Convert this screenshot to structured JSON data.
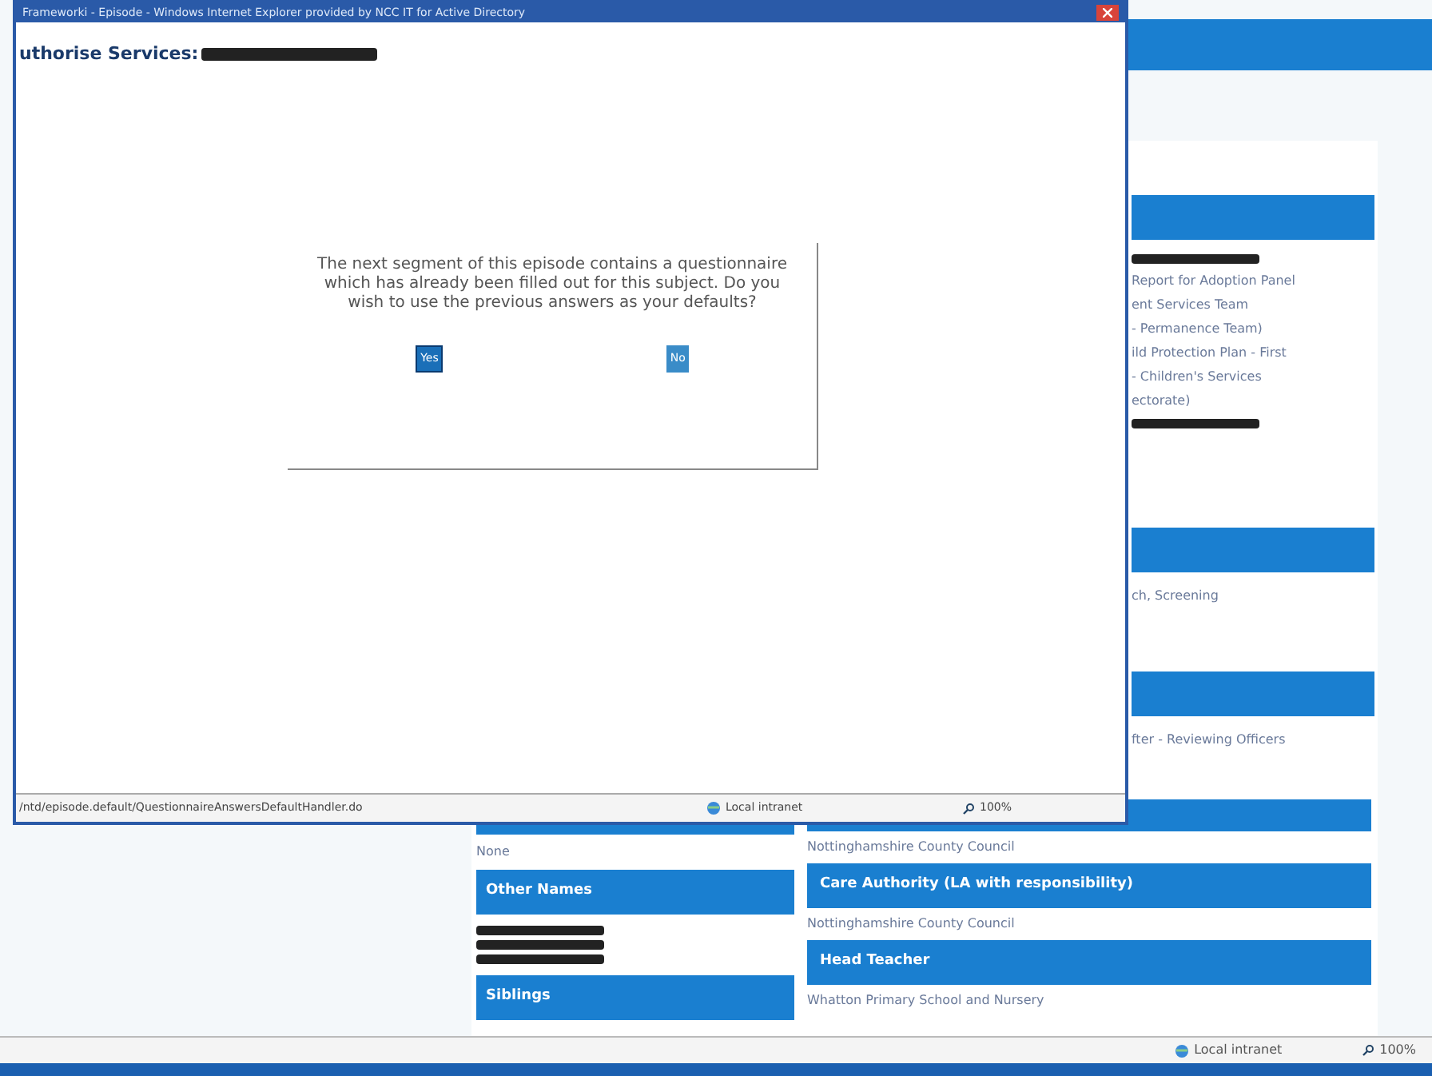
{
  "popup": {
    "title": "Frameworki - Episode - Windows Internet Explorer provided by NCC IT for Active Directory",
    "heading": "uthorise Services:",
    "dialog": {
      "message": "The next segment of this episode contains a questionnaire which has already been filled out for this subject. Do you wish to use the previous answers as your defaults?",
      "buttons": [
        {
          "label": "Yes",
          "selected": true
        },
        {
          "label": "No",
          "selected": false
        }
      ]
    },
    "status_bar": {
      "url": "/ntd/episode.default/QuestionnaireAnswersDefaultHandler.do",
      "zone": "Local intranet",
      "zoom": "100%"
    }
  },
  "page": {
    "side_sections": [
      {
        "lines": [
          {
            "kind": "redaction"
          },
          {
            "kind": "text",
            "text": "Report for Adoption Panel"
          },
          {
            "kind": "text",
            "text": "ent Services Team"
          },
          {
            "kind": "text",
            "text": "- Permanence Team)"
          },
          {
            "kind": "text",
            "text": "ild Protection Plan - First"
          },
          {
            "kind": "text",
            "text": "- Children's Services"
          },
          {
            "kind": "text",
            "text": "ectorate)"
          },
          {
            "kind": "redaction"
          }
        ]
      },
      {
        "lines": [
          {
            "kind": "text",
            "text": "ch, Screening"
          }
        ]
      },
      {
        "lines": [
          {
            "kind": "text",
            "text": "fter - Reviewing Officers"
          }
        ]
      }
    ],
    "left_column": [
      {
        "lines": [
          {
            "kind": "text",
            "text": "None"
          }
        ]
      },
      {
        "header": "Other Names",
        "lines": [
          {
            "kind": "redaction"
          },
          {
            "kind": "redaction"
          },
          {
            "kind": "redaction"
          }
        ]
      },
      {
        "header": "Siblings"
      }
    ],
    "right_column": [
      {
        "lines": [
          {
            "kind": "text",
            "text": "Nottinghamshire County Council"
          }
        ]
      },
      {
        "header": "Care Authority (LA with responsibility)",
        "lines": [
          {
            "kind": "text",
            "text": "Nottinghamshire County Council"
          }
        ]
      },
      {
        "header": "Head Teacher",
        "lines": [
          {
            "kind": "text",
            "text": "Whatton Primary School and Nursery"
          }
        ]
      }
    ],
    "status_bar": {
      "zone": "Local intranet",
      "zoom": "100%"
    }
  }
}
